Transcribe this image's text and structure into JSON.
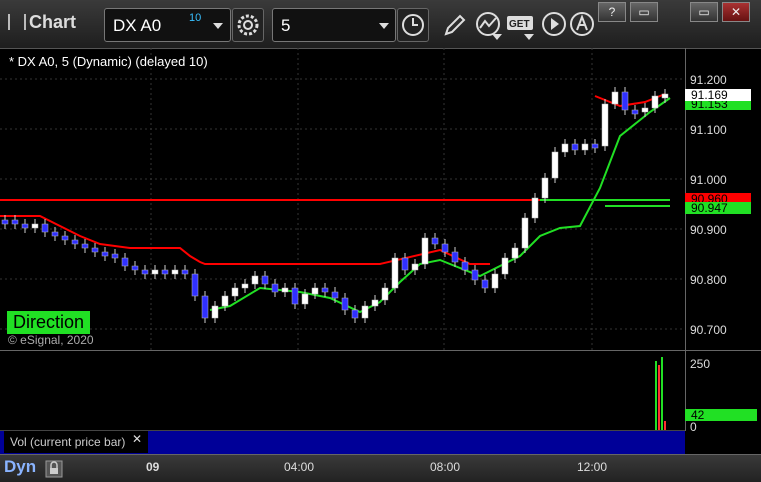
{
  "app": {
    "title": "Chart"
  },
  "toolbar": {
    "symbol": "DX A0",
    "symbol_superscript": "10",
    "interval": "5"
  },
  "window": {
    "help": "?",
    "restore": "▭",
    "minimize": "▭",
    "close": "✕"
  },
  "chart": {
    "title": "* DX A0, 5 (Dynamic) (delayed 10)",
    "watermark": "© eSignal, 2020",
    "direction_label": "Direction",
    "price_labels": [
      "91.200",
      "91.100",
      "91.000",
      "90.900",
      "90.800",
      "90.700"
    ],
    "last_price": "91.169",
    "tag_green_upper": "91.153",
    "tag_green_lower": "90.947",
    "tag_red": "90.960",
    "colors": {
      "red": "#ff0000",
      "green": "#21e024",
      "up": "#ffffff",
      "down": "#3030ff"
    }
  },
  "volume": {
    "study_label": "Vol (current price bar)",
    "close": "✕",
    "axis_labels": [
      "250",
      "0"
    ],
    "current": "42"
  },
  "time_axis": {
    "mode": "Dyn",
    "labels": [
      "09",
      "04:00",
      "08:00",
      "12:00"
    ]
  },
  "chart_data": {
    "type": "line",
    "series": [],
    "x": [
      "09",
      "04:00",
      "08:00",
      "12:00"
    ],
    "ylim": [
      90.68,
      91.24
    ]
  }
}
